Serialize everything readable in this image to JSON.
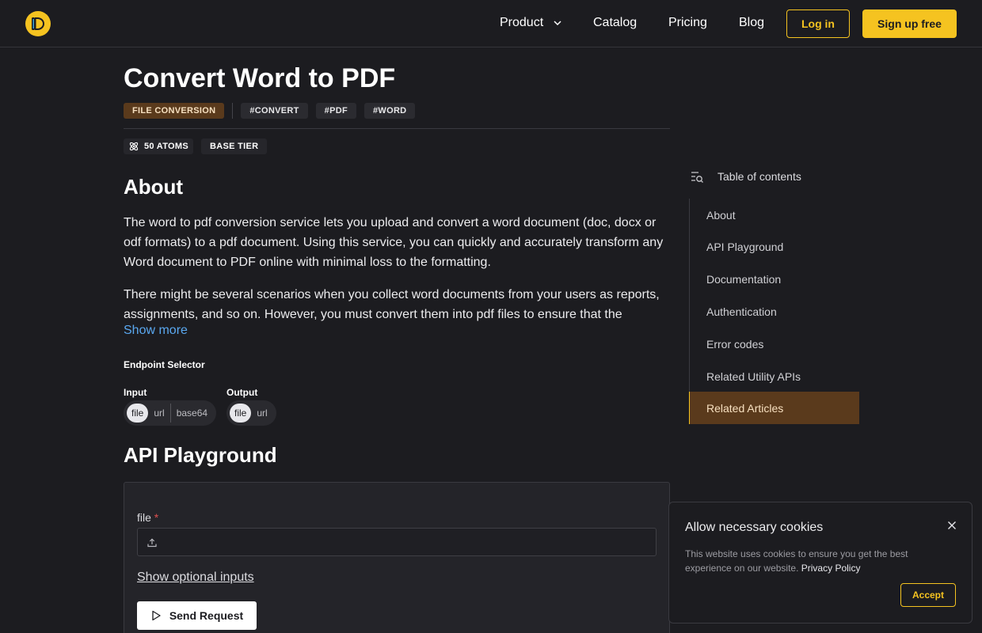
{
  "header": {
    "nav": [
      {
        "label": "Product"
      },
      {
        "label": "Catalog"
      },
      {
        "label": "Pricing"
      },
      {
        "label": "Blog"
      }
    ],
    "login_label": "Log in",
    "signup_label": "Sign up free"
  },
  "page": {
    "title": "Convert Word to PDF",
    "category": "FILE CONVERSION",
    "tags": [
      "#CONVERT",
      "#PDF",
      "#WORD"
    ],
    "atoms": "50 ATOMS",
    "tier": "BASE TIER"
  },
  "about": {
    "heading": "About",
    "para1": "The word to pdf conversion service lets you upload and convert a word document (doc, docx or odf formats) to a pdf document. Using this service, you can quickly and accurately transform any Word document to PDF online with minimal loss to the formatting.",
    "para2": "There might be several scenarios when you collect word documents from your users as reports, assignments, and so on. However, you must convert them into pdf files to ensure that the",
    "show_more": "Show more"
  },
  "endpoint": {
    "label": "Endpoint Selector",
    "input_label": "Input",
    "input_options": [
      "file",
      "url",
      "base64"
    ],
    "input_selected": "file",
    "output_label": "Output",
    "output_options": [
      "file",
      "url"
    ],
    "output_selected": "file"
  },
  "playground": {
    "heading": "API Playground",
    "file_label": "file",
    "required_mark": "*",
    "optional_link": "Show optional inputs",
    "send_label": "Send Request"
  },
  "toc": {
    "title": "Table of contents",
    "items": [
      {
        "label": "About"
      },
      {
        "label": "API Playground"
      },
      {
        "label": "Documentation"
      },
      {
        "label": "Authentication"
      },
      {
        "label": "Error codes"
      },
      {
        "label": "Related Utility APIs"
      },
      {
        "label": "Related Articles"
      }
    ],
    "active": "Related Articles"
  },
  "cookie": {
    "title": "Allow necessary cookies",
    "text": "This website uses cookies to ensure you get the best experience on our website.",
    "link": "Privacy Policy",
    "accept_label": "Accept"
  },
  "colors": {
    "background": "#1c1c20",
    "accent": "#f5c320",
    "category_bg": "#5a3a1c",
    "link": "#5aa8f0"
  },
  "icons": [
    "logo-icon",
    "chevron-down-icon",
    "atom-icon",
    "upload-icon",
    "play-icon",
    "toc-search-icon",
    "close-icon"
  ]
}
